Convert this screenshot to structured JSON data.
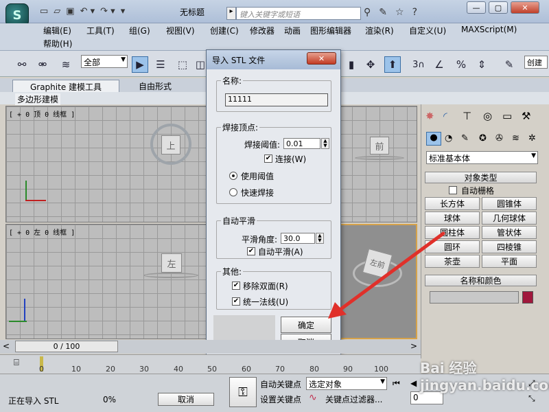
{
  "app": {
    "title": "无标题",
    "search_placeholder": "键入关键字或短语",
    "logo_text": "S"
  },
  "menus": {
    "row1": [
      "编辑(E)",
      "工具(T)",
      "组(G)",
      "视图(V)",
      "创建(C)",
      "修改器",
      "动画",
      "图形编辑器",
      "渲染(R)",
      "自定义(U)",
      "MAXScript(M)"
    ],
    "row2": [
      "帮助(H)"
    ]
  },
  "toolbar": {
    "selection_filter": "全部",
    "right_field": "创建"
  },
  "ribbon": {
    "tabs": [
      "Graphite 建模工具",
      "自由形式"
    ],
    "sub": "多边形建模"
  },
  "viewports": {
    "top_label": "[ + 0 顶 0 线框 ]",
    "left_label": "[ + 0 左 0 线框 ]",
    "top_cube": "上",
    "front_cube": "前",
    "left_cube": "左",
    "persp_cube": "左前"
  },
  "cmd": {
    "dropdown": "标准基本体",
    "object_type": "对象类型",
    "auto_grid": "自动栅格",
    "buttons": [
      "长方体",
      "圆锥体",
      "球体",
      "几何球体",
      "圆柱体",
      "管状体",
      "圆环",
      "四棱锥",
      "茶壶",
      "平面"
    ],
    "name_color": "名称和颜色",
    "color": "#a0183c"
  },
  "dialog": {
    "title": "导入 STL 文件",
    "name_group": "名称:",
    "name_value": "11111",
    "weld_group": "焊接顶点:",
    "weld_threshold_label": "焊接阈值:",
    "weld_threshold": "0.01",
    "weld_check": "连接(W)",
    "use_threshold": "使用阈值",
    "quick_weld": "快速焊接",
    "smooth_group": "自动平滑",
    "smooth_angle_label": "平滑角度:",
    "smooth_angle": "30.0",
    "auto_smooth": "自动平滑(A)",
    "other_group": "其他:",
    "remove_double": "移除双面(R)",
    "unify_normals": "统一法线(U)",
    "ok": "确定",
    "cancel": "取消"
  },
  "timeline": {
    "frame": "0 / 100",
    "ticks": [
      "0",
      "10",
      "20",
      "30",
      "40",
      "50",
      "60",
      "70",
      "80",
      "90",
      "100"
    ]
  },
  "status": {
    "text": "正在导入 STL",
    "percent": "0%",
    "cancel": "取消",
    "auto_key": "自动关键点",
    "set_key": "设置关键点",
    "selected": "选定对象",
    "key_filter": "关键点过滤器...",
    "frame_field": "0"
  },
  "watermark": "Bai 经验 jingyan.baidu.com"
}
